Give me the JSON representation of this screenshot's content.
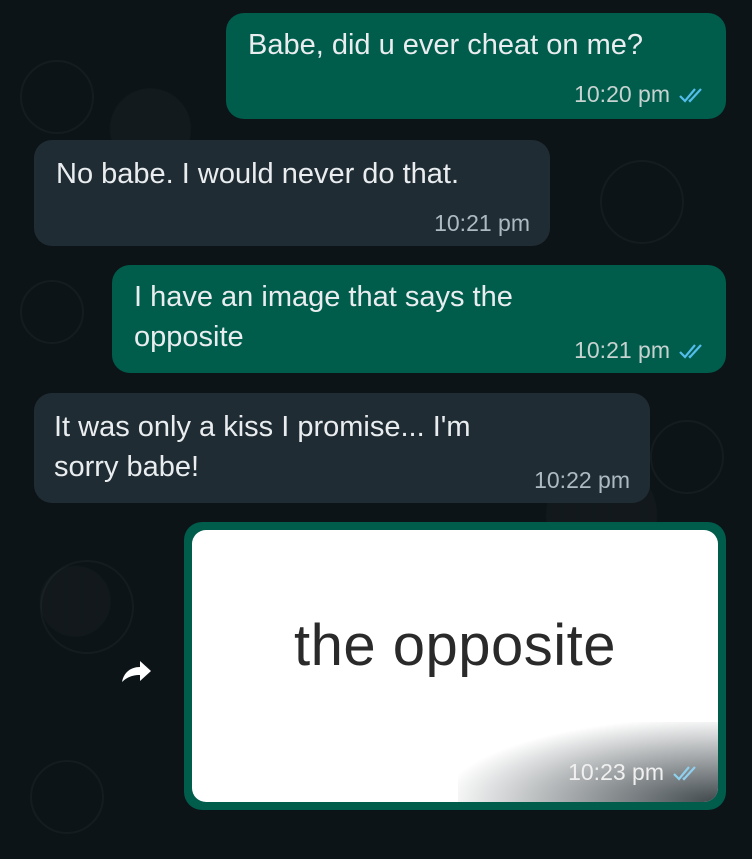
{
  "messages": [
    {
      "text": "Babe, did u ever cheat on me?",
      "time": "10:20 pm",
      "status": "read"
    },
    {
      "text": "No babe. I would never do that.",
      "time": "10:21 pm"
    },
    {
      "line1": "I have an image that says the",
      "line2": "opposite",
      "time": "10:21 pm",
      "status": "read"
    },
    {
      "line1": "It was only a kiss I promise... I'm",
      "line2": "sorry babe!",
      "time": "10:22 pm"
    }
  ],
  "image_message": {
    "caption_in_image": "the opposite",
    "time": "10:23 pm",
    "status": "read"
  },
  "icons": {
    "read_ticks": "double-check-icon",
    "forward": "forward-arrow-icon"
  },
  "colors": {
    "background": "#0d1418",
    "outgoing_bubble": "#005c4b",
    "incoming_bubble": "#202c33",
    "tick_color": "#53bdeb"
  }
}
